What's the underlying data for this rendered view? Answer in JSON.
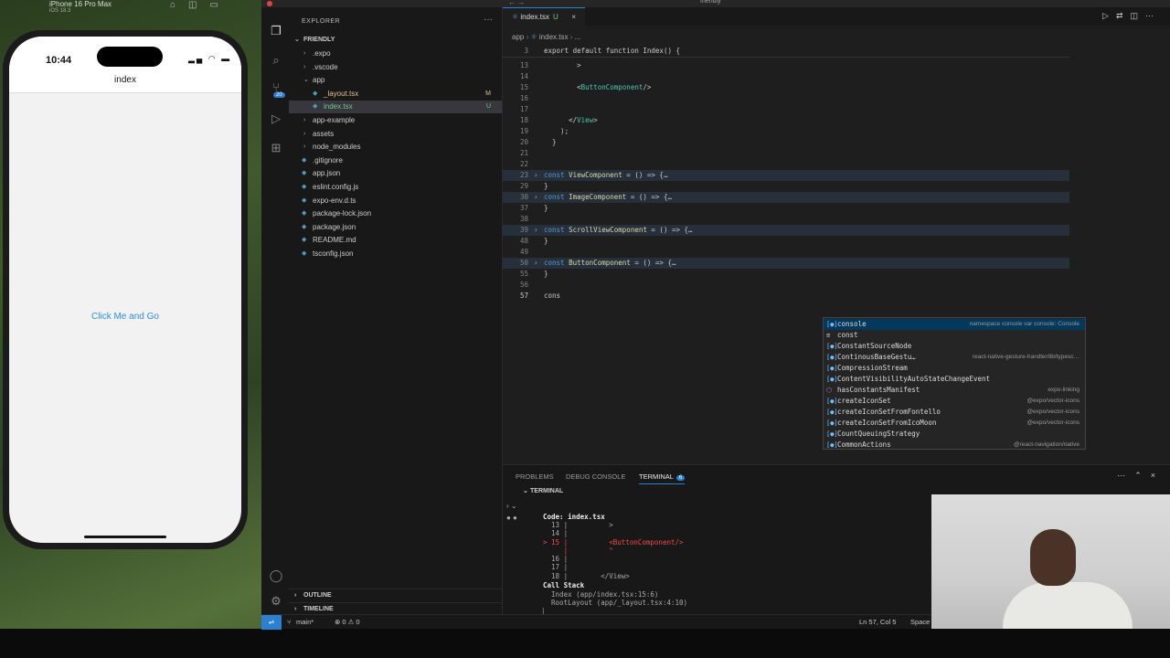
{
  "simulator": {
    "device_title": "iPhone 16 Pro Max",
    "os_version": "iOS 18.3",
    "time": "10:44",
    "screen_title": "index",
    "button_label": "Click Me and Go"
  },
  "vscode": {
    "window_title": "friendly",
    "explorer_title": "EXPLORER",
    "project_name": "FRIENDLY",
    "scm_badge": "20",
    "files": [
      {
        "name": ".expo",
        "kind": "folder",
        "state": "collapsed",
        "indent": 1
      },
      {
        "name": ".vscode",
        "kind": "folder",
        "state": "collapsed",
        "indent": 1
      },
      {
        "name": "app",
        "kind": "folder",
        "state": "expanded",
        "indent": 1
      },
      {
        "name": "_layout.tsx",
        "kind": "file",
        "badge": "M",
        "indent": 2
      },
      {
        "name": "index.tsx",
        "kind": "file",
        "badge": "U",
        "indent": 2
      },
      {
        "name": "app-example",
        "kind": "folder",
        "state": "collapsed",
        "indent": 1
      },
      {
        "name": "assets",
        "kind": "folder",
        "state": "collapsed",
        "indent": 1
      },
      {
        "name": "node_modules",
        "kind": "folder",
        "state": "collapsed",
        "indent": 1
      },
      {
        "name": ".gitignore",
        "kind": "file",
        "indent": 1
      },
      {
        "name": "app.json",
        "kind": "file",
        "indent": 1
      },
      {
        "name": "eslint.config.js",
        "kind": "file",
        "indent": 1
      },
      {
        "name": "expo-env.d.ts",
        "kind": "file",
        "indent": 1
      },
      {
        "name": "package-lock.json",
        "kind": "file",
        "indent": 1
      },
      {
        "name": "package.json",
        "kind": "file",
        "indent": 1
      },
      {
        "name": "README.md",
        "kind": "file",
        "indent": 1
      },
      {
        "name": "tsconfig.json",
        "kind": "file",
        "indent": 1
      }
    ],
    "outline_label": "OUTLINE",
    "timeline_label": "TIMELINE",
    "tab": {
      "name": "index.tsx",
      "status": "U"
    },
    "breadcrumb": [
      "app",
      "index.tsx",
      "..."
    ],
    "sticky_line": {
      "num": "3",
      "text": "export default function Index() {"
    },
    "code_lines": [
      {
        "num": "13",
        "text": "        >"
      },
      {
        "num": "14",
        "text": ""
      },
      {
        "num": "15",
        "text": "        <ButtonComponent/>"
      },
      {
        "num": "16",
        "text": ""
      },
      {
        "num": "17",
        "text": ""
      },
      {
        "num": "18",
        "text": "      </View>"
      },
      {
        "num": "19",
        "text": "    );"
      },
      {
        "num": "20",
        "text": "  }"
      },
      {
        "num": "21",
        "text": ""
      },
      {
        "num": "22",
        "text": ""
      },
      {
        "num": "23",
        "text": "const ViewComponent = () => {…",
        "folded": true
      },
      {
        "num": "29",
        "text": "}"
      },
      {
        "num": "30",
        "text": "const ImageComponent = () => {…",
        "folded": true
      },
      {
        "num": "37",
        "text": "}"
      },
      {
        "num": "38",
        "text": ""
      },
      {
        "num": "39",
        "text": "const ScrollViewComponent = () => {…",
        "folded": true
      },
      {
        "num": "48",
        "text": "}"
      },
      {
        "num": "49",
        "text": ""
      },
      {
        "num": "50",
        "text": "const ButtonComponent = () => {…",
        "folded": true
      },
      {
        "num": "55",
        "text": "}"
      },
      {
        "num": "56",
        "text": ""
      },
      {
        "num": "57",
        "text": "cons",
        "current": true
      }
    ],
    "suggestions": [
      {
        "label": "console",
        "detail": "namespace console var console: Console",
        "icon": "var",
        "selected": true
      },
      {
        "label": "const",
        "detail": "",
        "icon": "keyword"
      },
      {
        "label": "ConstantSourceNode",
        "detail": "",
        "icon": "var"
      },
      {
        "label": "ContinousBaseGestu…",
        "detail": "react-native-gesture-handler/lib/typesc…",
        "icon": "var"
      },
      {
        "label": "CompressionStream",
        "detail": "",
        "icon": "var"
      },
      {
        "label": "ContentVisibilityAutoStateChangeEvent",
        "detail": "",
        "icon": "var"
      },
      {
        "label": "hasConstantsManifest",
        "detail": "expo-linking",
        "icon": "function"
      },
      {
        "label": "createIconSet",
        "detail": "@expo/vector-icons",
        "icon": "var"
      },
      {
        "label": "createIconSetFromFontello",
        "detail": "@expo/vector-icons",
        "icon": "var"
      },
      {
        "label": "createIconSetFromIcoMoon",
        "detail": "@expo/vector-icons",
        "icon": "var"
      },
      {
        "label": "CountQueuingStrategy",
        "detail": "",
        "icon": "var"
      },
      {
        "label": "CommonActions",
        "detail": "@react-navigation/native",
        "icon": "var"
      }
    ],
    "panel_tabs": [
      {
        "label": "PROBLEMS"
      },
      {
        "label": "DEBUG CONSOLE"
      },
      {
        "label": "TERMINAL",
        "badge": "6",
        "active": true
      }
    ],
    "terminal_title": "TERMINAL",
    "terminal_lines": [
      {
        "text": "Code: index.tsx",
        "style": "bold"
      },
      {
        "text": "  13 |          >",
        "style": "dim"
      },
      {
        "text": "  14 |",
        "style": "dim"
      },
      {
        "text": "> 15 |          <ButtonComponent/>",
        "style": "err"
      },
      {
        "text": "     |          ^",
        "style": "err"
      },
      {
        "text": "  16 |",
        "style": "dim"
      },
      {
        "text": "  17 |",
        "style": "dim"
      },
      {
        "text": "  18 |        </View>",
        "style": "dim"
      },
      {
        "text": "Call Stack",
        "style": "bold"
      },
      {
        "text": "  Index (app/index.tsx:15:6)",
        "style": "dim"
      },
      {
        "text": "  RootLayout (app/_layout.tsx:4:10)",
        "style": "dim"
      },
      {
        "text": "▏",
        "style": "dim"
      }
    ],
    "status": {
      "branch": "main*",
      "problems": "⊗ 0 ⚠ 0",
      "cursor": "Ln 57, Col 5",
      "spaces": "Space"
    }
  }
}
